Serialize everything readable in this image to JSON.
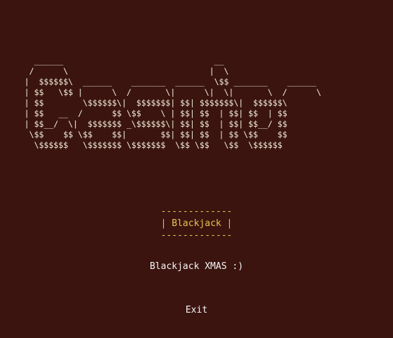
{
  "title_art": [
    "       ______                               __",
    "      /      \\                             |  \\",
    "     |  $$$$$$\\  ______    _______  ______  \\$$ _______    ______",
    "     | $$   \\$$ |      \\  /       \\|      \\|  \\|       \\  /      \\",
    "     | $$        \\$$$$$$\\|  $$$$$$$| $$| $$$$$$$\\|  $$$$$$\\",
    "     | $$   __  /      $$ \\$$    \\ | $$| $$  | $$| $$  | $$",
    "     | $$__/  \\|  $$$$$$$ _\\$$$$$$\\| $$| $$  | $$| $$__/ $$",
    "      \\$$    $$ \\$$    $$|       $$| $$| $$  | $$ \\$$    $$",
    "       \\$$$$$$   \\$$$$$$$ \\$$$$$$$  \\$$ \\$$   \\$$  \\$$$$$$"
  ],
  "menu": {
    "selected_top_border": "-------------",
    "selected_label": "| Blackjack |",
    "selected_bottom_border": "-------------",
    "items": [
      {
        "label": "Blackjack XMAS :)"
      },
      {
        "label": "Exit"
      }
    ]
  },
  "colors": {
    "background": "#3b1410",
    "text": "#f5f5f5",
    "highlight": "#e9c04a"
  }
}
